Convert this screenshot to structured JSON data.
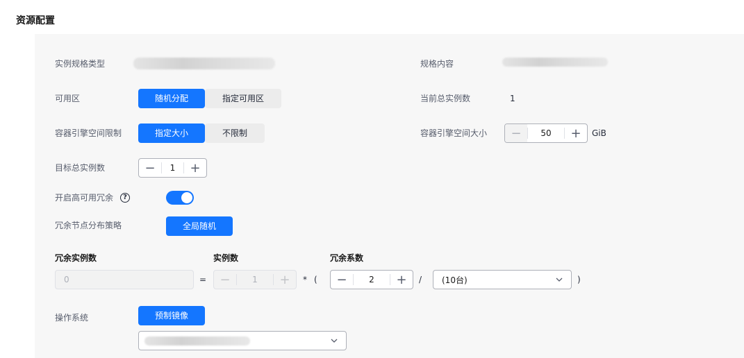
{
  "section_title": "资源配置",
  "fields": {
    "instance_spec_type": {
      "label": "实例规格类型"
    },
    "spec_content": {
      "label": "规格内容"
    },
    "availability_zone": {
      "label": "可用区",
      "options": [
        "随机分配",
        "指定可用区"
      ],
      "selected": "随机分配"
    },
    "current_total_instances": {
      "label": "当前总实例数",
      "value": "1"
    },
    "container_engine_space_limit": {
      "label": "容器引擎空间限制",
      "options": [
        "指定大小",
        "不限制"
      ],
      "selected": "指定大小"
    },
    "container_engine_space_size": {
      "label": "容器引擎空间大小",
      "value": "50",
      "unit": "GiB",
      "decrement": "−",
      "increment": "+"
    },
    "target_total_instances": {
      "label": "目标总实例数",
      "value": "1",
      "decrement": "−",
      "increment": "+"
    },
    "high_availability_redundancy": {
      "label": "开启高可用冗余",
      "help": "?",
      "enabled": true
    },
    "redundant_node_strategy": {
      "label": "冗余节点分布策略",
      "button": "全局随机"
    },
    "redundancy_formula": {
      "redundant_instances": {
        "label": "冗余实例数",
        "value": "0"
      },
      "equals": "=",
      "instances": {
        "label": "实例数",
        "value": "1",
        "decrement": "−",
        "increment": "+"
      },
      "times": "*",
      "open_paren": "(",
      "redundancy_factor": {
        "label": "冗余系数",
        "value": "2",
        "decrement": "−",
        "increment": "+"
      },
      "divide": "/",
      "unit_select": {
        "value": "(10台)"
      },
      "close_paren": ")"
    },
    "operating_system": {
      "label": "操作系统",
      "button": "预制镜像"
    }
  },
  "icons": {
    "chevron": "chevron-down-icon"
  },
  "colors": {
    "primary": "#1476ff",
    "panel_bg": "#f7f7f7"
  }
}
